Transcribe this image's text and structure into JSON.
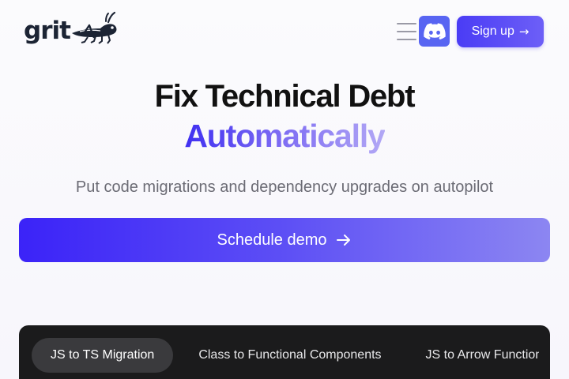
{
  "header": {
    "logo_text": "grit",
    "logo_icon": "cricket-icon",
    "menu_icon": "hamburger-icon",
    "discord_icon": "discord-icon",
    "signup_label": "Sign up",
    "signup_arrow": "→"
  },
  "hero": {
    "title": "Fix Technical Debt",
    "accent": "Automatically",
    "subtitle": "Put code migrations and dependency upgrades on autopilot",
    "cta_label": "Schedule demo",
    "cta_icon": "arrow-right-icon"
  },
  "migrations": {
    "tabs": [
      {
        "label": "JS to TS Migration",
        "active": true
      },
      {
        "label": "Class to Functional Components",
        "active": false
      },
      {
        "label": "JS to Arrow Functions",
        "active": false
      }
    ]
  },
  "colors": {
    "brand": "#4a3cf5",
    "discord": "#5865f2",
    "panel": "#1b1b1c",
    "logo": "#1c2434"
  }
}
